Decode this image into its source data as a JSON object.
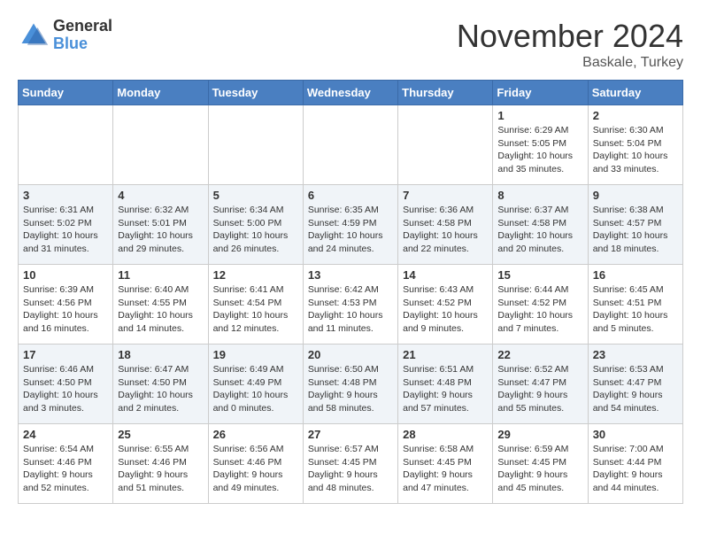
{
  "header": {
    "logo": {
      "general": "General",
      "blue": "Blue"
    },
    "title": "November 2024",
    "location": "Baskale, Turkey"
  },
  "weekdays": [
    "Sunday",
    "Monday",
    "Tuesday",
    "Wednesday",
    "Thursday",
    "Friday",
    "Saturday"
  ],
  "weeks": [
    [
      {
        "day": "",
        "info": ""
      },
      {
        "day": "",
        "info": ""
      },
      {
        "day": "",
        "info": ""
      },
      {
        "day": "",
        "info": ""
      },
      {
        "day": "",
        "info": ""
      },
      {
        "day": "1",
        "info": "Sunrise: 6:29 AM\nSunset: 5:05 PM\nDaylight: 10 hours and 35 minutes."
      },
      {
        "day": "2",
        "info": "Sunrise: 6:30 AM\nSunset: 5:04 PM\nDaylight: 10 hours and 33 minutes."
      }
    ],
    [
      {
        "day": "3",
        "info": "Sunrise: 6:31 AM\nSunset: 5:02 PM\nDaylight: 10 hours and 31 minutes."
      },
      {
        "day": "4",
        "info": "Sunrise: 6:32 AM\nSunset: 5:01 PM\nDaylight: 10 hours and 29 minutes."
      },
      {
        "day": "5",
        "info": "Sunrise: 6:34 AM\nSunset: 5:00 PM\nDaylight: 10 hours and 26 minutes."
      },
      {
        "day": "6",
        "info": "Sunrise: 6:35 AM\nSunset: 4:59 PM\nDaylight: 10 hours and 24 minutes."
      },
      {
        "day": "7",
        "info": "Sunrise: 6:36 AM\nSunset: 4:58 PM\nDaylight: 10 hours and 22 minutes."
      },
      {
        "day": "8",
        "info": "Sunrise: 6:37 AM\nSunset: 4:58 PM\nDaylight: 10 hours and 20 minutes."
      },
      {
        "day": "9",
        "info": "Sunrise: 6:38 AM\nSunset: 4:57 PM\nDaylight: 10 hours and 18 minutes."
      }
    ],
    [
      {
        "day": "10",
        "info": "Sunrise: 6:39 AM\nSunset: 4:56 PM\nDaylight: 10 hours and 16 minutes."
      },
      {
        "day": "11",
        "info": "Sunrise: 6:40 AM\nSunset: 4:55 PM\nDaylight: 10 hours and 14 minutes."
      },
      {
        "day": "12",
        "info": "Sunrise: 6:41 AM\nSunset: 4:54 PM\nDaylight: 10 hours and 12 minutes."
      },
      {
        "day": "13",
        "info": "Sunrise: 6:42 AM\nSunset: 4:53 PM\nDaylight: 10 hours and 11 minutes."
      },
      {
        "day": "14",
        "info": "Sunrise: 6:43 AM\nSunset: 4:52 PM\nDaylight: 10 hours and 9 minutes."
      },
      {
        "day": "15",
        "info": "Sunrise: 6:44 AM\nSunset: 4:52 PM\nDaylight: 10 hours and 7 minutes."
      },
      {
        "day": "16",
        "info": "Sunrise: 6:45 AM\nSunset: 4:51 PM\nDaylight: 10 hours and 5 minutes."
      }
    ],
    [
      {
        "day": "17",
        "info": "Sunrise: 6:46 AM\nSunset: 4:50 PM\nDaylight: 10 hours and 3 minutes."
      },
      {
        "day": "18",
        "info": "Sunrise: 6:47 AM\nSunset: 4:50 PM\nDaylight: 10 hours and 2 minutes."
      },
      {
        "day": "19",
        "info": "Sunrise: 6:49 AM\nSunset: 4:49 PM\nDaylight: 10 hours and 0 minutes."
      },
      {
        "day": "20",
        "info": "Sunrise: 6:50 AM\nSunset: 4:48 PM\nDaylight: 9 hours and 58 minutes."
      },
      {
        "day": "21",
        "info": "Sunrise: 6:51 AM\nSunset: 4:48 PM\nDaylight: 9 hours and 57 minutes."
      },
      {
        "day": "22",
        "info": "Sunrise: 6:52 AM\nSunset: 4:47 PM\nDaylight: 9 hours and 55 minutes."
      },
      {
        "day": "23",
        "info": "Sunrise: 6:53 AM\nSunset: 4:47 PM\nDaylight: 9 hours and 54 minutes."
      }
    ],
    [
      {
        "day": "24",
        "info": "Sunrise: 6:54 AM\nSunset: 4:46 PM\nDaylight: 9 hours and 52 minutes."
      },
      {
        "day": "25",
        "info": "Sunrise: 6:55 AM\nSunset: 4:46 PM\nDaylight: 9 hours and 51 minutes."
      },
      {
        "day": "26",
        "info": "Sunrise: 6:56 AM\nSunset: 4:46 PM\nDaylight: 9 hours and 49 minutes."
      },
      {
        "day": "27",
        "info": "Sunrise: 6:57 AM\nSunset: 4:45 PM\nDaylight: 9 hours and 48 minutes."
      },
      {
        "day": "28",
        "info": "Sunrise: 6:58 AM\nSunset: 4:45 PM\nDaylight: 9 hours and 47 minutes."
      },
      {
        "day": "29",
        "info": "Sunrise: 6:59 AM\nSunset: 4:45 PM\nDaylight: 9 hours and 45 minutes."
      },
      {
        "day": "30",
        "info": "Sunrise: 7:00 AM\nSunset: 4:44 PM\nDaylight: 9 hours and 44 minutes."
      }
    ]
  ]
}
